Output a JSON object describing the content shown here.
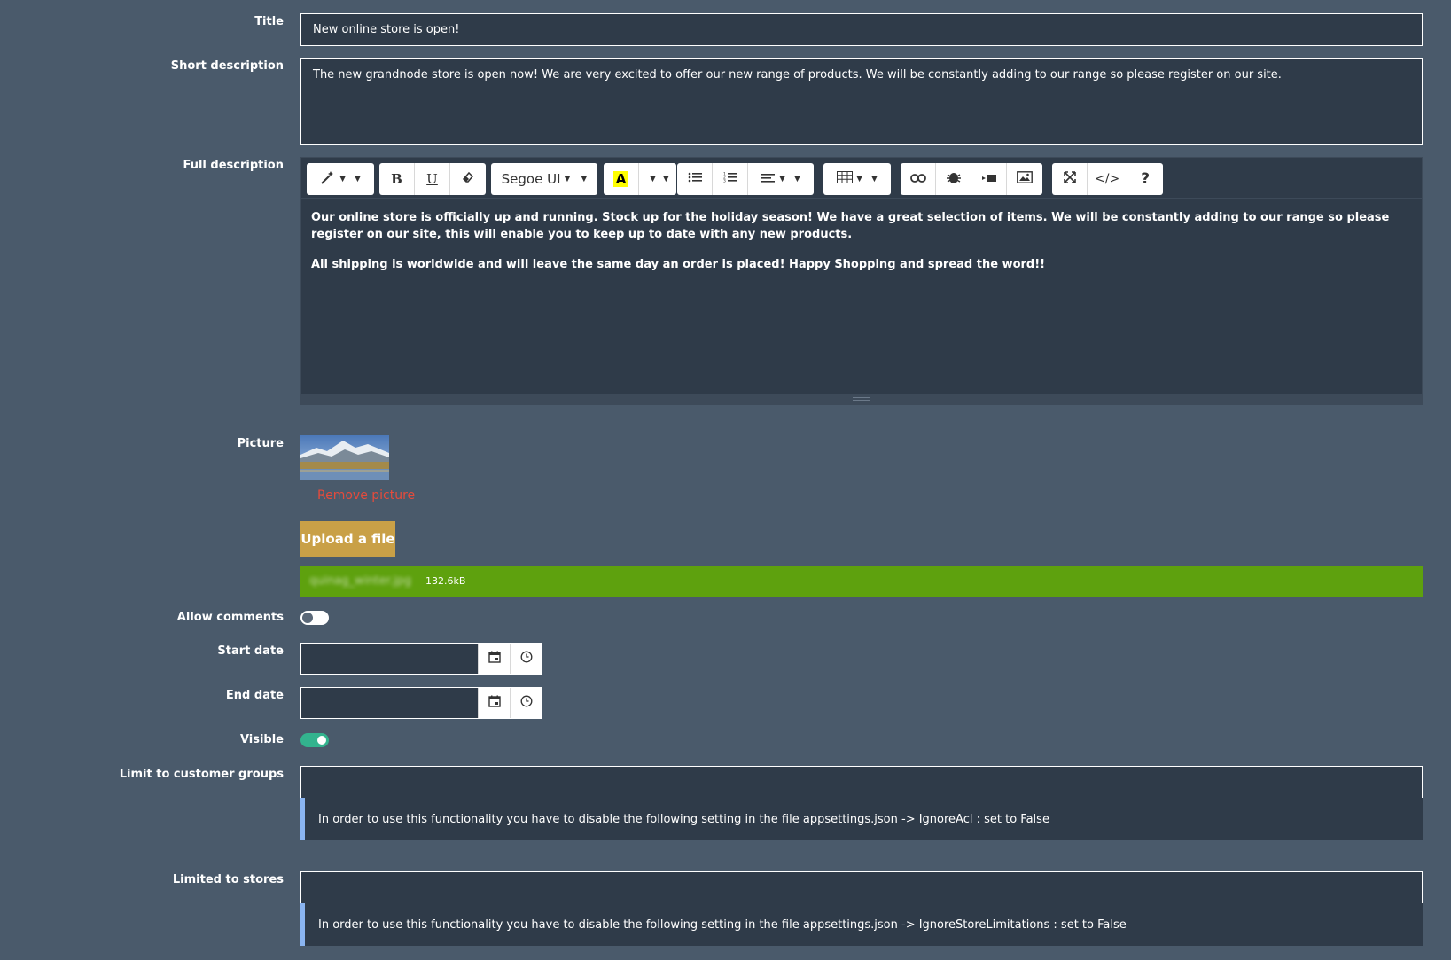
{
  "title": {
    "label": "Title",
    "value": "New online store is open!"
  },
  "short_description": {
    "label": "Short description",
    "value": "The new grandnode store is open now! We are very excited to offer our new range of products. We will be constantly adding to our range so please register on our site."
  },
  "full_description": {
    "label": "Full description",
    "toolbar": {
      "font_name": "Segoe UI",
      "bold": "B",
      "underline": "U",
      "color_letter": "A",
      "code_view": "</>",
      "help": "?"
    },
    "paragraphs": [
      "Our online store is officially up and running. Stock up for the holiday season! We have a great selection of items. We will be constantly adding to our range so please register on our site, this will enable you to keep up to date with any new products.",
      "All shipping is worldwide and will leave the same day an order is placed! Happy Shopping and spread the word!!"
    ]
  },
  "picture": {
    "label": "Picture",
    "remove_link": "Remove picture",
    "upload_button": "Upload a file",
    "file_name": "quinag_winter.jpg",
    "file_size": "132.6kB",
    "upload_progress": 1.0
  },
  "allow_comments": {
    "label": "Allow comments",
    "checked": false
  },
  "start_date": {
    "label": "Start date",
    "value": ""
  },
  "end_date": {
    "label": "End date",
    "value": ""
  },
  "visible": {
    "label": "Visible",
    "checked": true
  },
  "customer_groups": {
    "label": "Limit to customer groups",
    "value": "",
    "note": "In order to use this functionality you have to disable the following setting in the file appsettings.json -> IgnoreAcl : set to False"
  },
  "stores": {
    "label": "Limited to stores",
    "value": "",
    "note": "In order to use this functionality you have to disable the following setting in the file appsettings.json -> IgnoreStoreLimitations : set to False"
  },
  "colors": {
    "background": "#4a5a6b",
    "field_bg": "#2f3b49",
    "accent_green": "#5ea10e",
    "upload_gold": "#c9a047",
    "danger_red": "#e54b3c",
    "toggle_on": "#33b38e",
    "note_border": "#8ab4f0"
  },
  "icons": {
    "magic": "magic-wand-icon",
    "eraser": "eraser-icon",
    "ul": "unordered-list-icon",
    "ol": "ordered-list-icon",
    "align": "align-icon",
    "table": "table-icon",
    "link": "link-icon",
    "bug": "bug-icon",
    "video": "video-icon",
    "image": "image-icon",
    "fullscreen": "fullscreen-icon",
    "calendar": "calendar-icon",
    "clock": "clock-icon"
  }
}
